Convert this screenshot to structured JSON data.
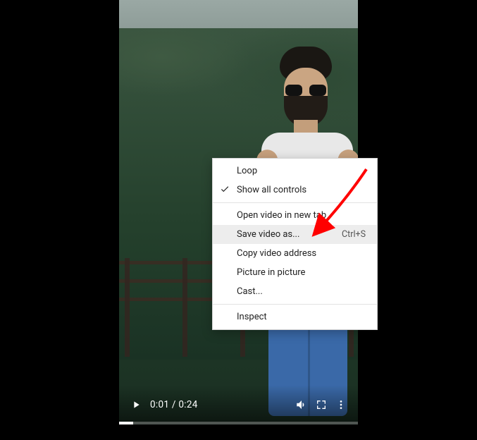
{
  "video": {
    "current_time": "0:01",
    "duration": "0:24",
    "time_display": "0:01 / 0:24",
    "progress_percent": 6
  },
  "context_menu": {
    "items": [
      {
        "label": "Loop",
        "checked": false
      },
      {
        "label": "Show all controls",
        "checked": true
      }
    ],
    "items2": [
      {
        "label": "Open video in new tab"
      },
      {
        "label": "Save video as...",
        "shortcut": "Ctrl+S",
        "highlight": true
      },
      {
        "label": "Copy video address"
      },
      {
        "label": "Picture in picture"
      },
      {
        "label": "Cast..."
      }
    ],
    "items3": [
      {
        "label": "Inspect"
      }
    ]
  },
  "annotation": {
    "arrow_color": "#ff0000",
    "points_to": "Save video as..."
  }
}
